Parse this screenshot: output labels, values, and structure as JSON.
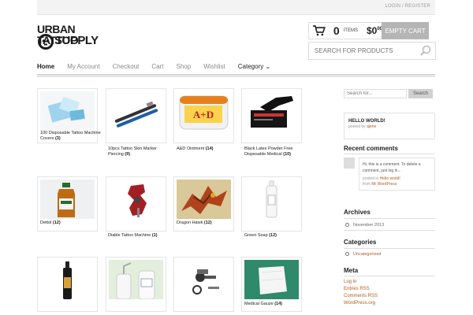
{
  "top": {
    "links": "LOGIN / REGISTER"
  },
  "logo": {
    "line1": "URBAN TATTOO",
    "line2": "SUPPLY"
  },
  "cart": {
    "count": "0",
    "items_label": "ITEMS",
    "total": "$0",
    "total_cents": "00",
    "empty_label": "EMPTY CART"
  },
  "search": {
    "placeholder": "SEARCH FOR PRODUCTS"
  },
  "nav": {
    "items": [
      "Home",
      "My Account",
      "Checkout",
      "Cart",
      "Shop",
      "Wishlist",
      "Category"
    ]
  },
  "products": [
    {
      "name": "100 Disposable Tattoo Machine Covers",
      "count": "(3)"
    },
    {
      "name": "10pcs Tattoo Skin Marker Piercing",
      "count": "(9)"
    },
    {
      "name": "A&D Ointment",
      "count": "(14)"
    },
    {
      "name": "Black Latex Powder Free Dispesable Medical",
      "count": "(10)"
    },
    {
      "name": "Dettol",
      "count": "(12)"
    },
    {
      "name": "Diable Tattoo Machine",
      "count": "(1)"
    },
    {
      "name": "Dragon Hawk",
      "count": "(12)"
    },
    {
      "name": "Green Soap",
      "count": "(12)"
    },
    {
      "name": "",
      "count": ""
    },
    {
      "name": "",
      "count": ""
    },
    {
      "name": "",
      "count": ""
    },
    {
      "name": "Medical Gauze",
      "count": "(14)"
    }
  ],
  "sidebar": {
    "search_placeholder": "Search for...",
    "search_button": "Search",
    "hello": {
      "title": "HELLO WORLD!",
      "posted_by": "posted by",
      "author": "ajene"
    },
    "recent_comments": {
      "heading": "Recent comments",
      "text": "Hi, this is a comment. To delete a comment, just log in...",
      "posted_in": "posted in",
      "post": "Hello world!",
      "from": "from",
      "commenter": "Mr WordPress"
    },
    "archives": {
      "heading": "Archives",
      "item": "November 2013"
    },
    "categories": {
      "heading": "Categories",
      "item": "Uncategorized"
    },
    "meta": {
      "heading": "Meta",
      "links": [
        "Log in",
        "Entries RSS",
        "Comments RSS",
        "WordPress.org"
      ]
    }
  },
  "colors": {
    "accent": "#b35c1e",
    "button_gray": "#b5b5b5"
  }
}
